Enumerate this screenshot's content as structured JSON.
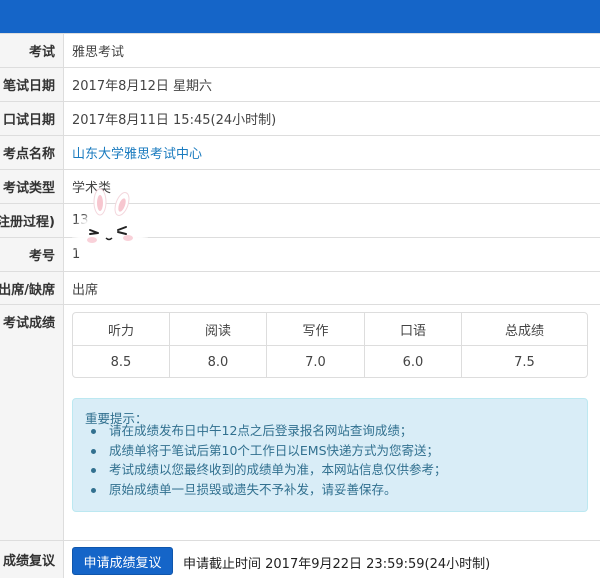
{
  "rows": {
    "exam": {
      "label": "考试",
      "value": "雅思考试"
    },
    "written_date": {
      "label": "笔试日期",
      "value": "2017年8月12日 星期六"
    },
    "oral_date": {
      "label": "口试日期",
      "value": "2017年8月11日 15:45(24小时制)"
    },
    "center": {
      "label": "考点名称",
      "value": "山东大学雅思考试中心"
    },
    "type": {
      "label": "考试类型",
      "value": "学术类"
    },
    "registration": {
      "label": "注册过程)",
      "value": "13"
    },
    "exam_no": {
      "label": "考号",
      "value": "1"
    },
    "attendance": {
      "label": "出席/缺席",
      "value": "出席"
    },
    "results": {
      "label": "考试成绩"
    },
    "recheck": {
      "label": "成绩复议"
    }
  },
  "scores": {
    "headers": [
      "听力",
      "阅读",
      "写作",
      "口语",
      "总成绩"
    ],
    "values": [
      "8.5",
      "8.0",
      "7.0",
      "6.0",
      "7.5"
    ]
  },
  "notice": {
    "title": "重要提示：",
    "items": [
      "请在成绩发布日中午12点之后登录报名网站查询成绩；",
      "成绩单将于笔试后第10个工作日以EMS快递方式为您寄送；",
      "考试成绩以您最终收到的成绩单为准，本网站信息仅供参考；",
      "原始成绩单一旦损毁或遗失不予补发，请妥善保存。"
    ]
  },
  "recheck_button": "申请成绩复议",
  "deadline": "申请截止时间 2017年9月22日 23:59:59(24小时制)",
  "colors": {
    "topbar": "#1565c8",
    "link": "#1a7bbf",
    "notice_bg": "#d9edf7"
  },
  "icons": {
    "sticker": "bunny-sticker-icon"
  }
}
